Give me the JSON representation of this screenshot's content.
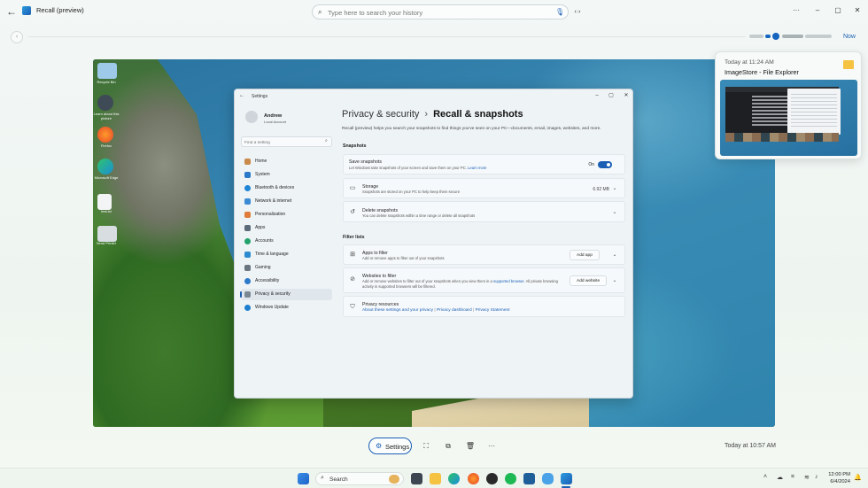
{
  "window": {
    "title": "Recall (preview)",
    "search_placeholder": "Type here to search your history",
    "controls": {
      "more": "···",
      "minimize": "–",
      "maximize": "▢",
      "close": "✕"
    }
  },
  "timeline": {
    "now_label": "Now"
  },
  "preview": {
    "time": "Today at 11:24 AM",
    "app": "ImageStore - File Explorer"
  },
  "desktop_icons": [
    "Recycle Bin",
    "Learn about this picture",
    "Firefox",
    "Microsoft Edge",
    "test.txt",
    "Send Printer"
  ],
  "settings": {
    "title": "Settings",
    "user": {
      "name": "Andrew",
      "account": "Local Account"
    },
    "find_placeholder": "Find a setting",
    "nav": [
      "Home",
      "System",
      "Bluetooth & devices",
      "Network & internet",
      "Personalization",
      "Apps",
      "Accounts",
      "Time & language",
      "Gaming",
      "Accessibility",
      "Privacy & security",
      "Windows Update"
    ],
    "active_nav": "Privacy & security",
    "breadcrumb": {
      "parent": "Privacy & security",
      "sep": "›",
      "current": "Recall & snapshots"
    },
    "description": "Recall (preview) helps you search your snapshots to find things you've seen on your PC—documents, email, images, websites, and more.",
    "snapshots_header": "Snapshots",
    "save": {
      "title": "Save snapshots",
      "sub": "Let Windows take snapshots of your screen and save them on your PC.",
      "link": "Learn more",
      "toggle_label": "On"
    },
    "storage": {
      "title": "Storage",
      "sub": "Snapshots are stored on your PC to help keep them secure",
      "value": "6.92 MB"
    },
    "delete": {
      "title": "Delete snapshots",
      "sub": "You can delete snapshots within a time range or delete all snapshots"
    },
    "filter_header": "Filter lists",
    "apps_filter": {
      "title": "Apps to filter",
      "sub": "Add or remove apps to filter out of your snapshots",
      "button": "Add app"
    },
    "websites_filter": {
      "title": "Websites to filter",
      "sub": "Add or remove websites to filter out of your snapshots when you view them in a",
      "sub_link": "supported browser",
      "sub_tail": ". All private browsing activity in supported browsers will be filtered.",
      "button": "Add website"
    },
    "resources": {
      "title": "Privacy resources",
      "links": [
        "About these settings and your privacy",
        "Privacy dashboard",
        "Privacy Statement"
      ]
    }
  },
  "actions": {
    "settings_label": "Settings",
    "snapshot_time": "Today at 10:57 AM"
  },
  "taskbar": {
    "search_label": "Search",
    "time": "12:00 PM",
    "date": "6/4/2024"
  },
  "colors": {
    "accent": "#1a5fb4",
    "folder": "#f5c242"
  }
}
